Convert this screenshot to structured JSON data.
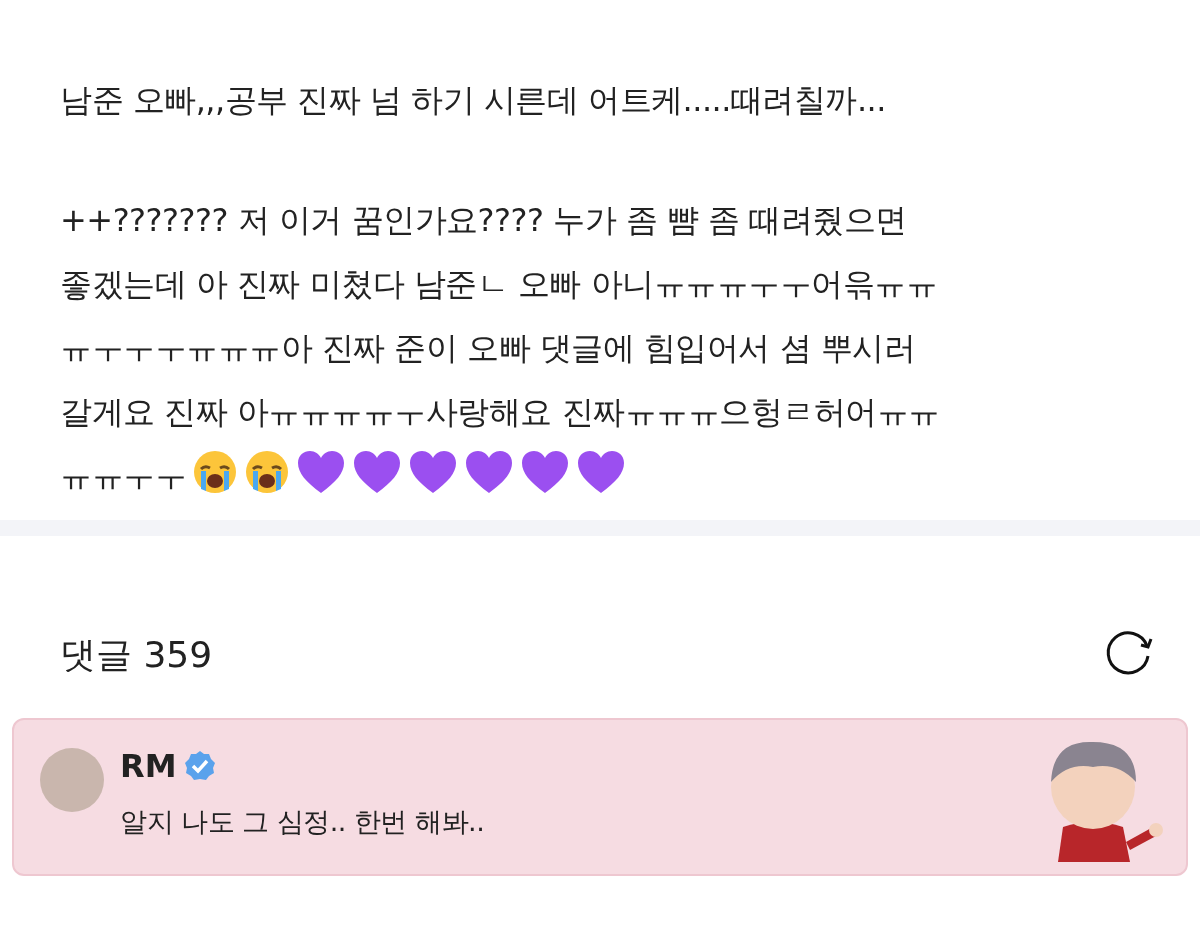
{
  "post": {
    "paragraphs": [
      [
        "남준 오빠,,,공부 진짜 넘 하기 시른데 어트케.....때려칠까..."
      ],
      [
        "++??????? 저 이거 꿈인가요???? 누가 좀 뺨 좀 때려줬으면",
        "좋겠는데 아 진짜 미쳤다 남준ㄴ 오빠 아니ㅠㅠㅠㅜㅜ어윾ㅠㅠ",
        "ㅠㅜㅜㅜㅠㅠㅠ아 진짜 준이 오빠 댓글에 힘입어서 셤 뿌시러",
        "갈게요 진짜 아ㅠㅠㅠㅠㅜ사랑해요 진짜ㅠㅠㅠ으헝ㄹ허어ㅠㅠ",
        "ㅠㅠㅜㅜ"
      ]
    ],
    "emoji": [
      {
        "kind": "crying"
      },
      {
        "kind": "crying"
      },
      {
        "kind": "heart"
      },
      {
        "kind": "heart"
      },
      {
        "kind": "heart"
      },
      {
        "kind": "heart"
      },
      {
        "kind": "heart"
      },
      {
        "kind": "heart"
      }
    ]
  },
  "comments_header": {
    "label": "댓글 359"
  },
  "comments": [
    {
      "author": "RM",
      "verified": true,
      "text": "알지 나도 그 심정.. 한번 해봐.."
    }
  ]
}
